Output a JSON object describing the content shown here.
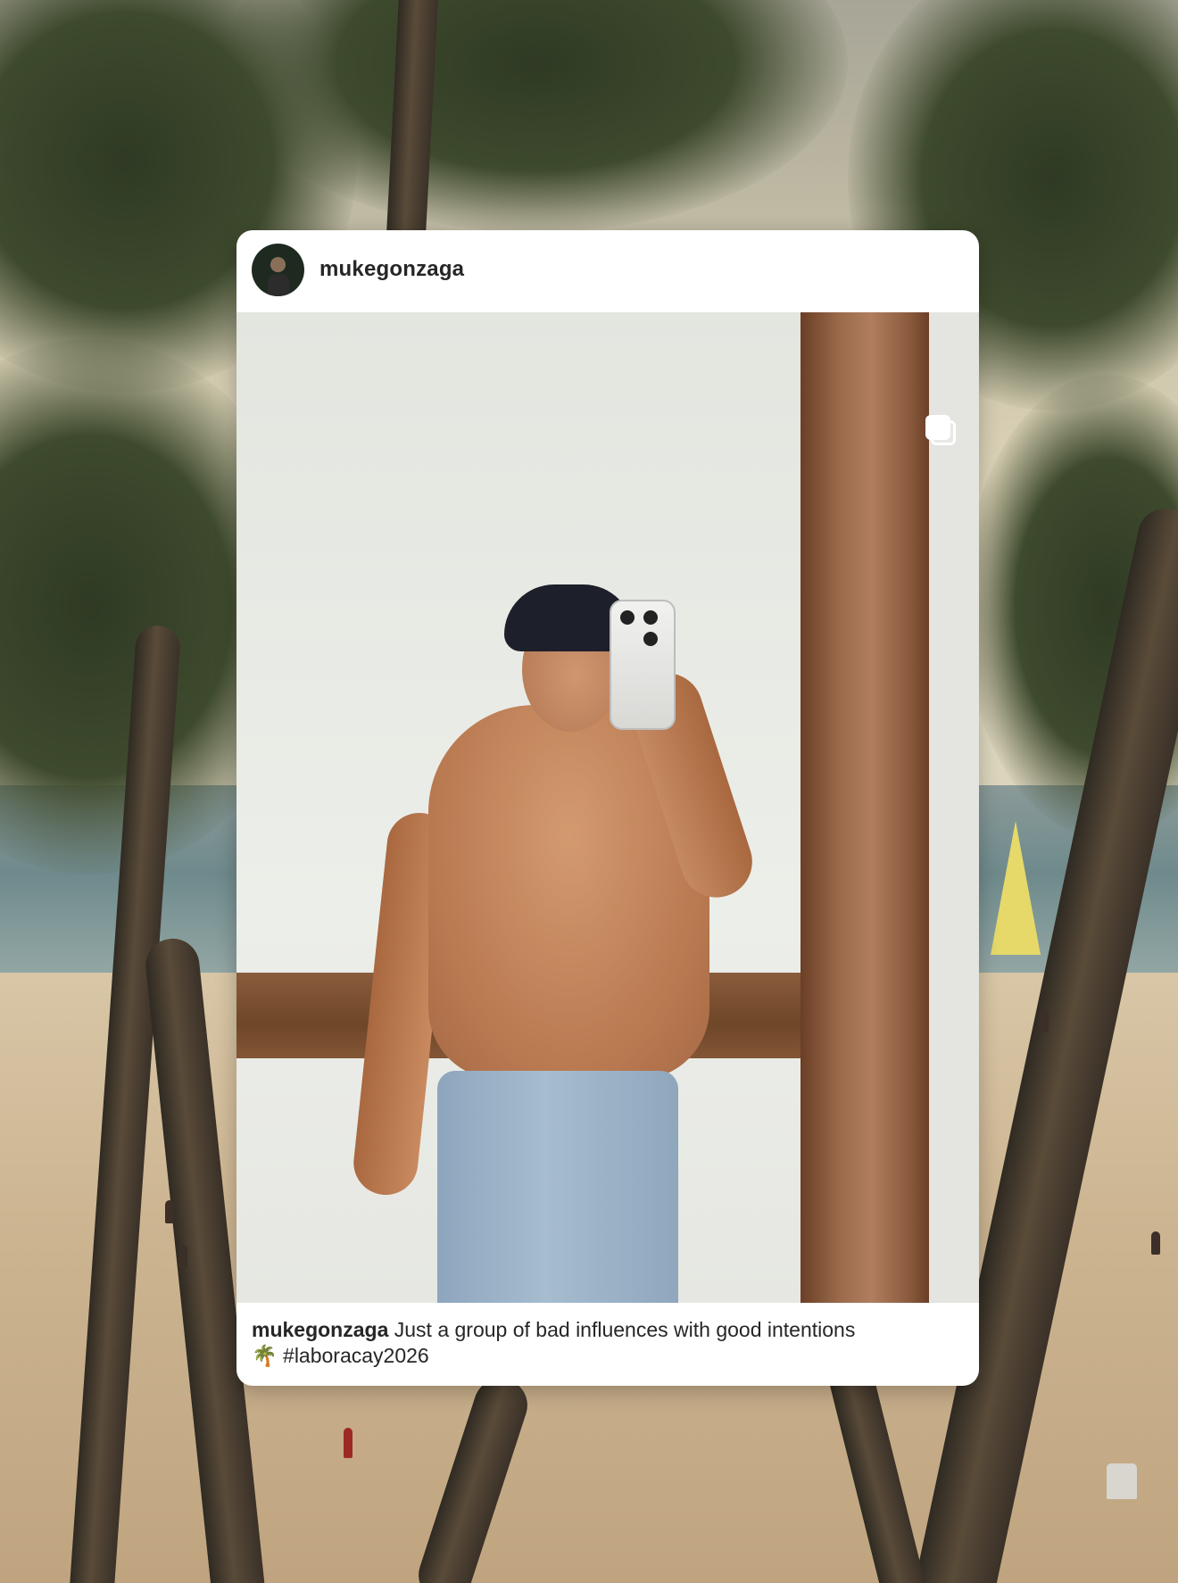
{
  "post": {
    "username": "mukegonzaga",
    "caption_username": "mukegonzaga",
    "caption_text": "Just a group of bad influences with good intentions",
    "caption_emoji": "🌴",
    "hashtag": "#laboracay2026"
  },
  "icons": {
    "avatar": "profile-avatar",
    "multi_photo": "multiple-photos-icon"
  }
}
